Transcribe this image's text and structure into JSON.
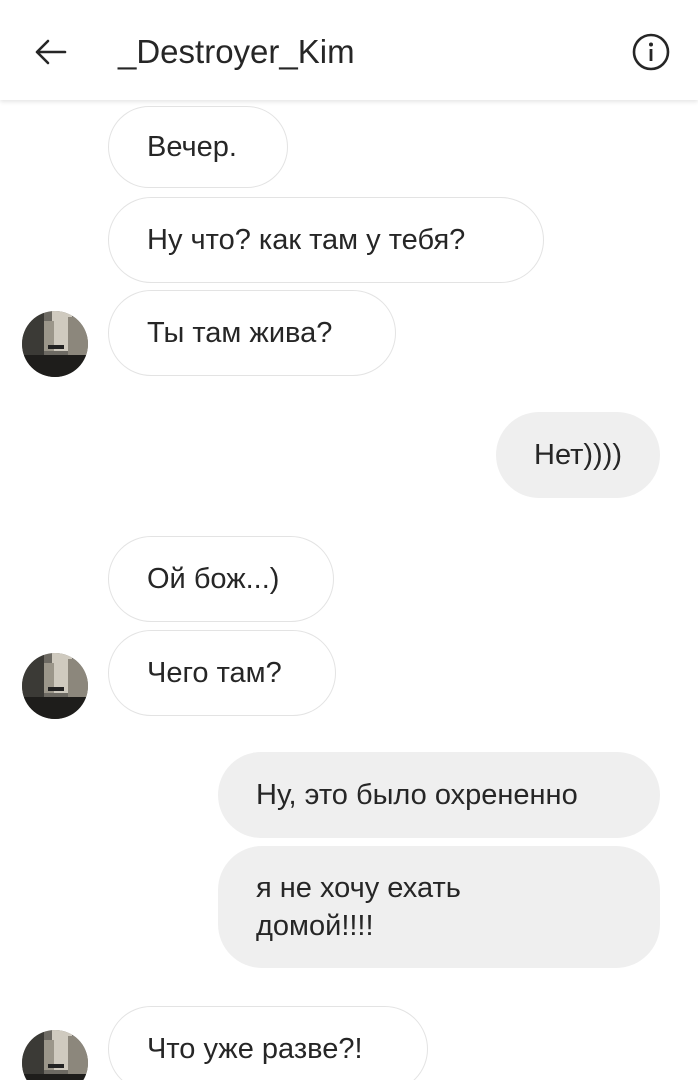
{
  "header": {
    "back_icon": "arrow-left-icon",
    "username": "_Destroyer_Kim",
    "info_icon": "info-circle-icon"
  },
  "messages": [
    {
      "direction": "incoming",
      "text": "Вечер."
    },
    {
      "direction": "incoming",
      "text": "Ну что? как там у тебя?"
    },
    {
      "direction": "incoming",
      "text": "Ты там жива?"
    },
    {
      "direction": "outgoing",
      "text": "Нет))))"
    },
    {
      "direction": "incoming",
      "text": "Ой бож...)"
    },
    {
      "direction": "incoming",
      "text": "Чего там?"
    },
    {
      "direction": "outgoing",
      "text": "Ну, это было охрененно"
    },
    {
      "direction": "outgoing",
      "text": "я не хочу ехать домой!!!!"
    },
    {
      "direction": "incoming",
      "text": "Что уже разве?!"
    }
  ],
  "colors": {
    "incoming_bubble_bg": "#ffffff",
    "incoming_bubble_border": "#e3e3e3",
    "outgoing_bubble_bg": "#efefef",
    "text": "#262626"
  }
}
